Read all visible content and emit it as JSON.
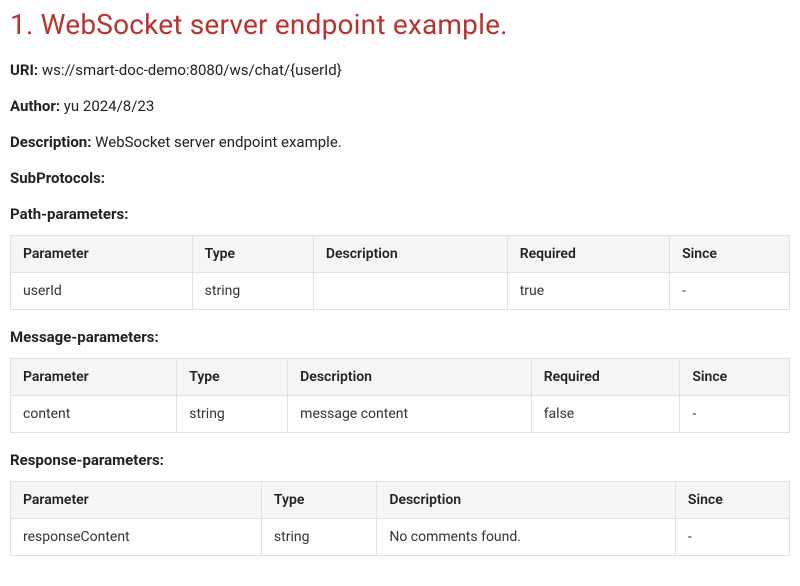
{
  "title": "1. WebSocket server endpoint example.",
  "uri": {
    "label": "URI:",
    "value": "ws://smart-doc-demo:8080/ws/chat/{userId}"
  },
  "author": {
    "label": "Author:",
    "value": "yu 2024/8/23"
  },
  "description": {
    "label": "Description:",
    "value": "WebSocket server endpoint example."
  },
  "subprotocols": {
    "label": "SubProtocols:"
  },
  "pathParams": {
    "label": "Path-parameters:",
    "headers": [
      "Parameter",
      "Type",
      "Description",
      "Required",
      "Since"
    ],
    "rows": [
      [
        "userId",
        "string",
        "",
        "true",
        "-"
      ]
    ]
  },
  "messageParams": {
    "label": "Message-parameters:",
    "headers": [
      "Parameter",
      "Type",
      "Description",
      "Required",
      "Since"
    ],
    "rows": [
      [
        "content",
        "string",
        "message content",
        "false",
        "-"
      ]
    ]
  },
  "responseParams": {
    "label": "Response-parameters:",
    "headers": [
      "Parameter",
      "Type",
      "Description",
      "Since"
    ],
    "rows": [
      [
        "responseContent",
        "string",
        "No comments found.",
        "-"
      ]
    ]
  }
}
